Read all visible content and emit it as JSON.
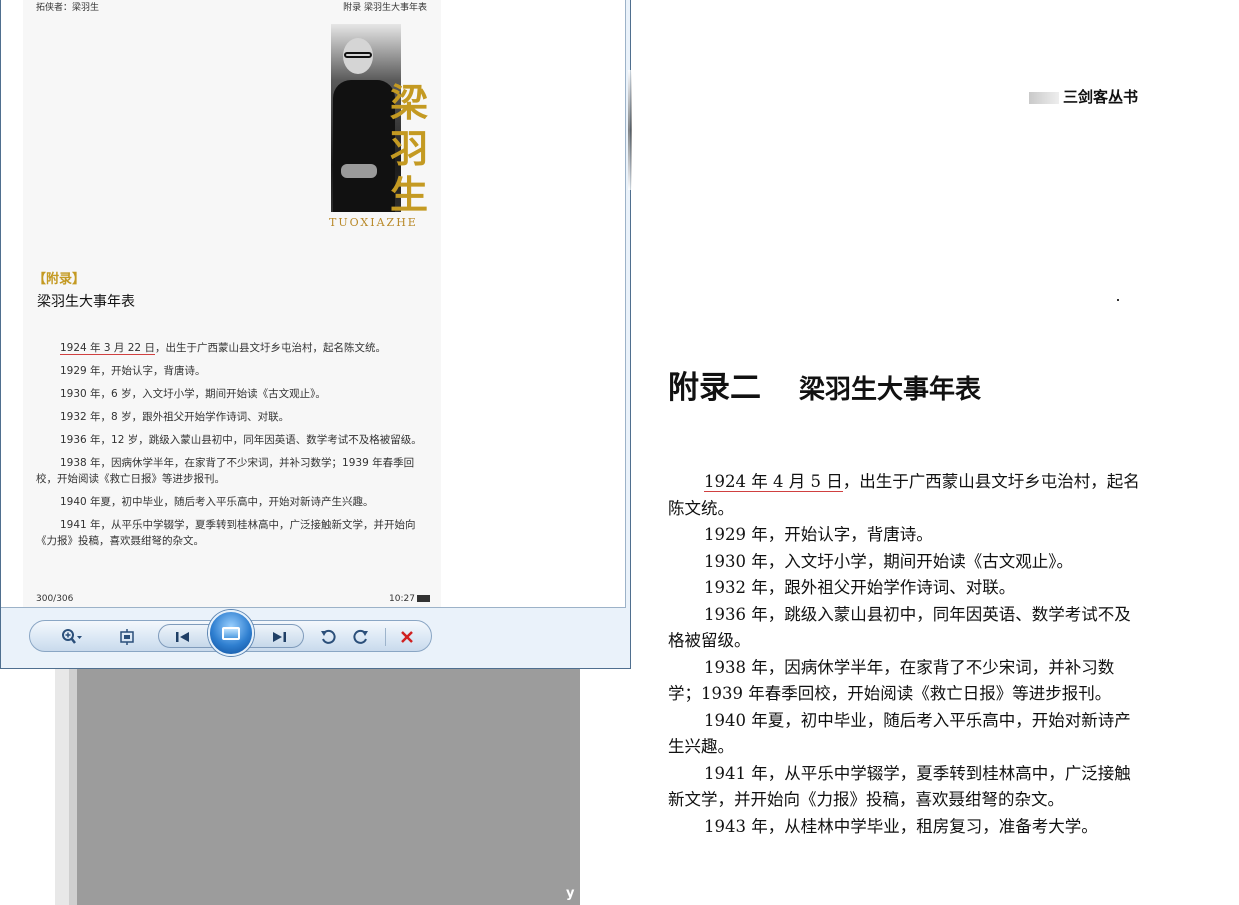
{
  "viewer": {
    "phone": {
      "header_left": "拓侠者：梁羽生",
      "header_right": "附录 梁羽生大事年表",
      "calligraphy": [
        "梁",
        "羽",
        "生"
      ],
      "cover_caption": "TUOXIAZHE",
      "appendix_tag": "【附录】",
      "title": "梁羽生大事年表",
      "paragraphs": [
        {
          "highlight": "1924 年 3 月 22 日",
          "text": "，出生于广西蒙山县文圩乡屯治村，起名陈文统。"
        },
        {
          "highlight": "",
          "text": "1929 年，开始认字，背唐诗。"
        },
        {
          "highlight": "",
          "text": "1930 年，6 岁，入文圩小学，期间开始读《古文观止》。"
        },
        {
          "highlight": "",
          "text": "1932 年，8 岁，跟外祖父开始学作诗词、对联。"
        },
        {
          "highlight": "",
          "text": "1936 年，12 岁，跳级入蒙山县初中，同年因英语、数学考试不及格被留级。"
        },
        {
          "highlight": "",
          "text": "1938 年，因病休学半年，在家背了不少宋词，并补习数学；1939 年春季回校，开始阅读《救亡日报》等进步报刊。"
        },
        {
          "highlight": "",
          "text": "1940 年夏，初中毕业，随后考入平乐高中，开始对新诗产生兴趣。"
        },
        {
          "highlight": "",
          "text": "1941 年，从平乐中学辍学，夏季转到桂林高中，广泛接触新文学，并开始向《力报》投稿，喜欢聂绀弩的杂文。"
        }
      ],
      "footer_page": "300/306",
      "footer_time": "10:27"
    },
    "toolbar": {
      "zoom_icon": "zoom-icon",
      "fit_icon": "actual-size-icon",
      "prev_icon": "previous-icon",
      "slideshow_icon": "slideshow-icon",
      "next_icon": "next-icon",
      "rotate_ccw_icon": "rotate-ccw-icon",
      "rotate_cw_icon": "rotate-cw-icon",
      "delete_icon": "delete-icon",
      "delete_color": "#d02020",
      "accent_color": "#2f7fd0"
    }
  },
  "book": {
    "series": "三剑客丛书",
    "chapter_label": "附录二",
    "chapter_title": "梁羽生大事年表",
    "paragraphs": [
      {
        "highlight": "1924 年 4 月 5 日",
        "text": "，出生于广西蒙山县文圩乡屯治村，起名陈文统。"
      },
      {
        "highlight": "",
        "text": "1929 年，开始认字，背唐诗。"
      },
      {
        "highlight": "",
        "text": "1930 年，入文圩小学，期间开始读《古文观止》。"
      },
      {
        "highlight": "",
        "text": "1932 年，跟外祖父开始学作诗词、对联。"
      },
      {
        "highlight": "",
        "text": "1936 年，跳级入蒙山县初中，同年因英语、数学考试不及格被留级。"
      },
      {
        "highlight": "",
        "text": "1938 年，因病休学半年，在家背了不少宋词，并补习数学；1939 年春季回校，开始阅读《救亡日报》等进步报刊。"
      },
      {
        "highlight": "",
        "text": "1940 年夏，初中毕业，随后考入平乐高中，开始对新诗产生兴趣。"
      },
      {
        "highlight": "",
        "text": "1941 年，从平乐中学辍学，夏季转到桂林高中，广泛接触新文学，并开始向《力报》投稿，喜欢聂绀弩的杂文。"
      },
      {
        "highlight": "",
        "text": "1943 年，从桂林中学毕业，租房复习，准备考大学。"
      }
    ]
  },
  "background": {
    "watermark": "y"
  }
}
